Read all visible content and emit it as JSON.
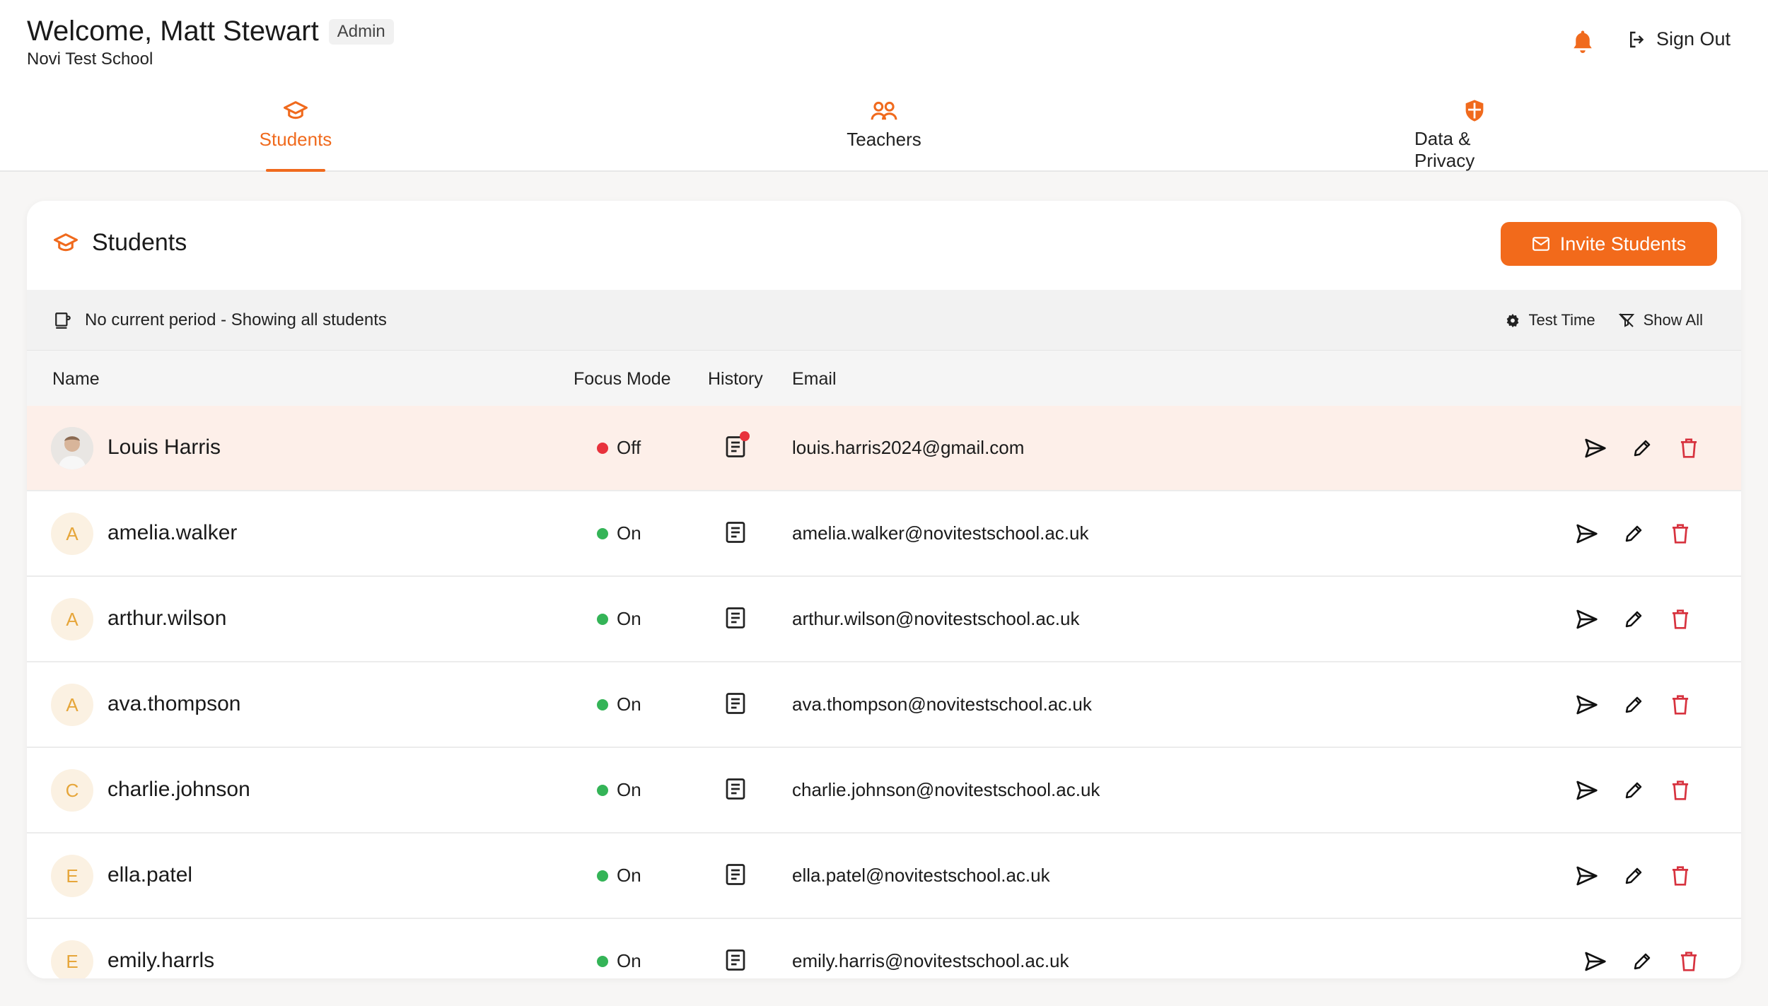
{
  "header": {
    "welcome": "Welcome, Matt Stewart",
    "role": "Admin",
    "school": "Novi Test School",
    "sign_out": "Sign Out"
  },
  "tabs": [
    {
      "label": "Students",
      "icon": "graduation-cap-icon",
      "active": true
    },
    {
      "label": "Teachers",
      "icon": "users-icon",
      "active": false
    },
    {
      "label": "Data & Privacy",
      "icon": "shield-icon",
      "active": false
    }
  ],
  "card": {
    "title": "Students",
    "invite_label": "Invite Students",
    "period_text": "No current period - Showing all students",
    "test_time": "Test Time",
    "show_all": "Show All"
  },
  "table": {
    "columns": {
      "name": "Name",
      "focus": "Focus Mode",
      "history": "History",
      "email": "Email"
    },
    "rows": [
      {
        "initial": "",
        "name": "Louis Harris",
        "focus": "Off",
        "email": "louis.harris2024@gmail.com",
        "photo": true,
        "flagged": true,
        "history_alert": true
      },
      {
        "initial": "A",
        "name": "amelia.walker",
        "focus": "On",
        "email": "amelia.walker@novitestschool.ac.uk"
      },
      {
        "initial": "A",
        "name": "arthur.wilson",
        "focus": "On",
        "email": "arthur.wilson@novitestschool.ac.uk"
      },
      {
        "initial": "A",
        "name": "ava.thompson",
        "focus": "On",
        "email": "ava.thompson@novitestschool.ac.uk"
      },
      {
        "initial": "C",
        "name": "charlie.johnson",
        "focus": "On",
        "email": "charlie.johnson@novitestschool.ac.uk"
      },
      {
        "initial": "E",
        "name": "ella.patel",
        "focus": "On",
        "email": "ella.patel@novitestschool.ac.uk"
      },
      {
        "initial": "E",
        "name": "emily.harrls",
        "focus": "On",
        "email": "emily.harris@novitestschool.ac.uk"
      }
    ]
  },
  "colors": {
    "accent": "#f06a1d",
    "on": "#34b457",
    "off": "#e8323c",
    "delete": "#d7333f"
  }
}
